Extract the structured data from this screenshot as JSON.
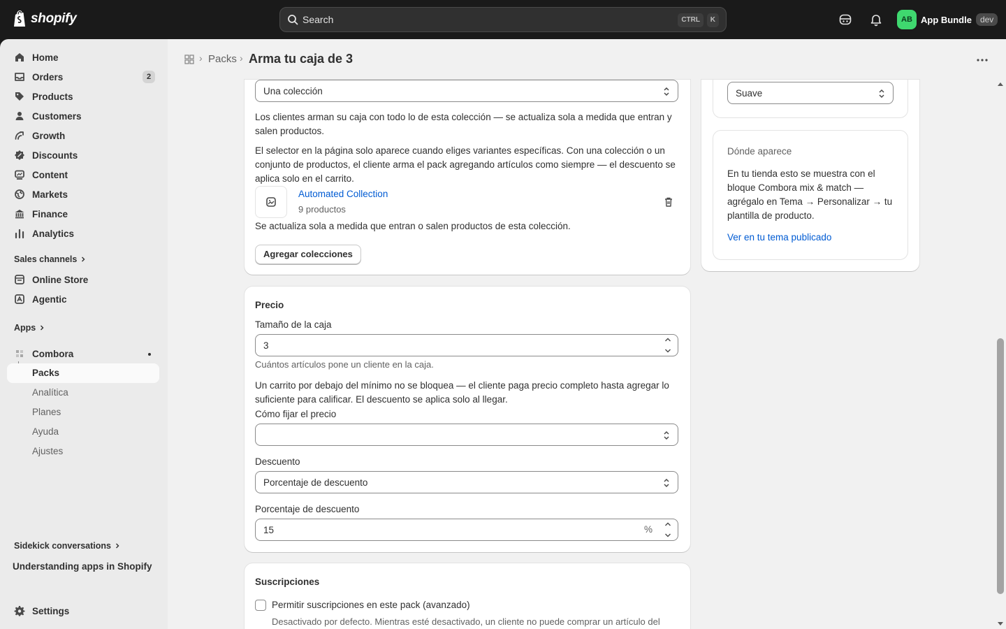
{
  "topbar": {
    "logo_text": "shopify",
    "search_placeholder": "Search",
    "shortcut_ctrl": "CTRL",
    "shortcut_k": "K",
    "account_initials": "AB",
    "account_name": "App Bundle",
    "account_badge": "dev",
    "avatar_color": "#3fd86f"
  },
  "sidebar": {
    "items": [
      {
        "label": "Home",
        "icon": "home-icon"
      },
      {
        "label": "Orders",
        "icon": "orders-icon",
        "badge": "2"
      },
      {
        "label": "Products",
        "icon": "tag-icon"
      },
      {
        "label": "Customers",
        "icon": "person-icon"
      },
      {
        "label": "Growth",
        "icon": "growth-icon"
      },
      {
        "label": "Discounts",
        "icon": "discount-icon"
      },
      {
        "label": "Content",
        "icon": "content-icon"
      },
      {
        "label": "Markets",
        "icon": "globe-icon"
      },
      {
        "label": "Finance",
        "icon": "bank-icon"
      },
      {
        "label": "Analytics",
        "icon": "bar-chart-icon"
      }
    ],
    "sales_channels_label": "Sales channels",
    "channels": [
      {
        "label": "Online Store",
        "icon": "store-icon"
      },
      {
        "label": "Agentic",
        "icon": "agentic-icon"
      }
    ],
    "apps_label": "Apps",
    "app_name": "Combora",
    "app_subitems": [
      "Packs",
      "Analítica",
      "Planes",
      "Ayuda",
      "Ajustes"
    ],
    "sidekick_label": "Sidekick conversations",
    "sidekick_item": "Understanding apps in Shopify",
    "settings_label": "Settings"
  },
  "breadcrumb": {
    "parent": "Packs",
    "title": "Arma tu caja de 3"
  },
  "collection_card": {
    "source_select": "Una colección",
    "desc1": "Los clientes arman su caja con todo lo de esta colección — se actualiza sola a medida que entran y salen productos.",
    "desc2": "El selector en la página solo aparece cuando eliges variantes específicas. Con una colección o un conjunto de productos, el cliente arma el pack agregando artículos como siempre — el descuento se aplica solo en el carrito.",
    "collection_name": "Automated Collection",
    "collection_count": "9 productos",
    "collection_note": "Se actualiza sola a medida que entran o salen productos de esta colección.",
    "add_button": "Agregar colecciones"
  },
  "price_card": {
    "heading": "Precio",
    "box_size_label": "Tamaño de la caja",
    "box_size_value": "3",
    "box_size_help": "Cuántos artículos pone un cliente en la caja.",
    "cart_note": "Un carrito por debajo del mínimo no se bloquea — el cliente paga precio completo hasta agregar lo suficiente para calificar. El descuento se aplica solo al llegar.",
    "pricing_label": "Cómo fijar el precio",
    "pricing_value": "",
    "discount_label": "Descuento",
    "discount_value": "Porcentaje de descuento",
    "percent_label": "Porcentaje de descuento",
    "percent_value": "15",
    "percent_suffix": "%"
  },
  "subscriptions_card": {
    "heading": "Suscripciones",
    "checkbox_label": "Permitir suscripciones en este pack (avanzado)",
    "checkbox_checked": false,
    "help": "Desactivado por defecto. Mientras esté desactivado, un cliente no puede comprar un artículo del"
  },
  "side_top_card": {
    "select_value": "Suave"
  },
  "where_card": {
    "heading": "Dónde aparece",
    "body": "En tu tienda esto se muestra con el bloque Combora mix & match — agrégalo en Tema → Personalizar → tu plantilla de producto.",
    "link": "Ver en tu tema publicado"
  },
  "colors": {
    "link": "#005bd3",
    "topbar_bg": "#1a1a1a",
    "sidebar_bg": "#ebebeb",
    "main_bg": "#f1f1f1"
  }
}
